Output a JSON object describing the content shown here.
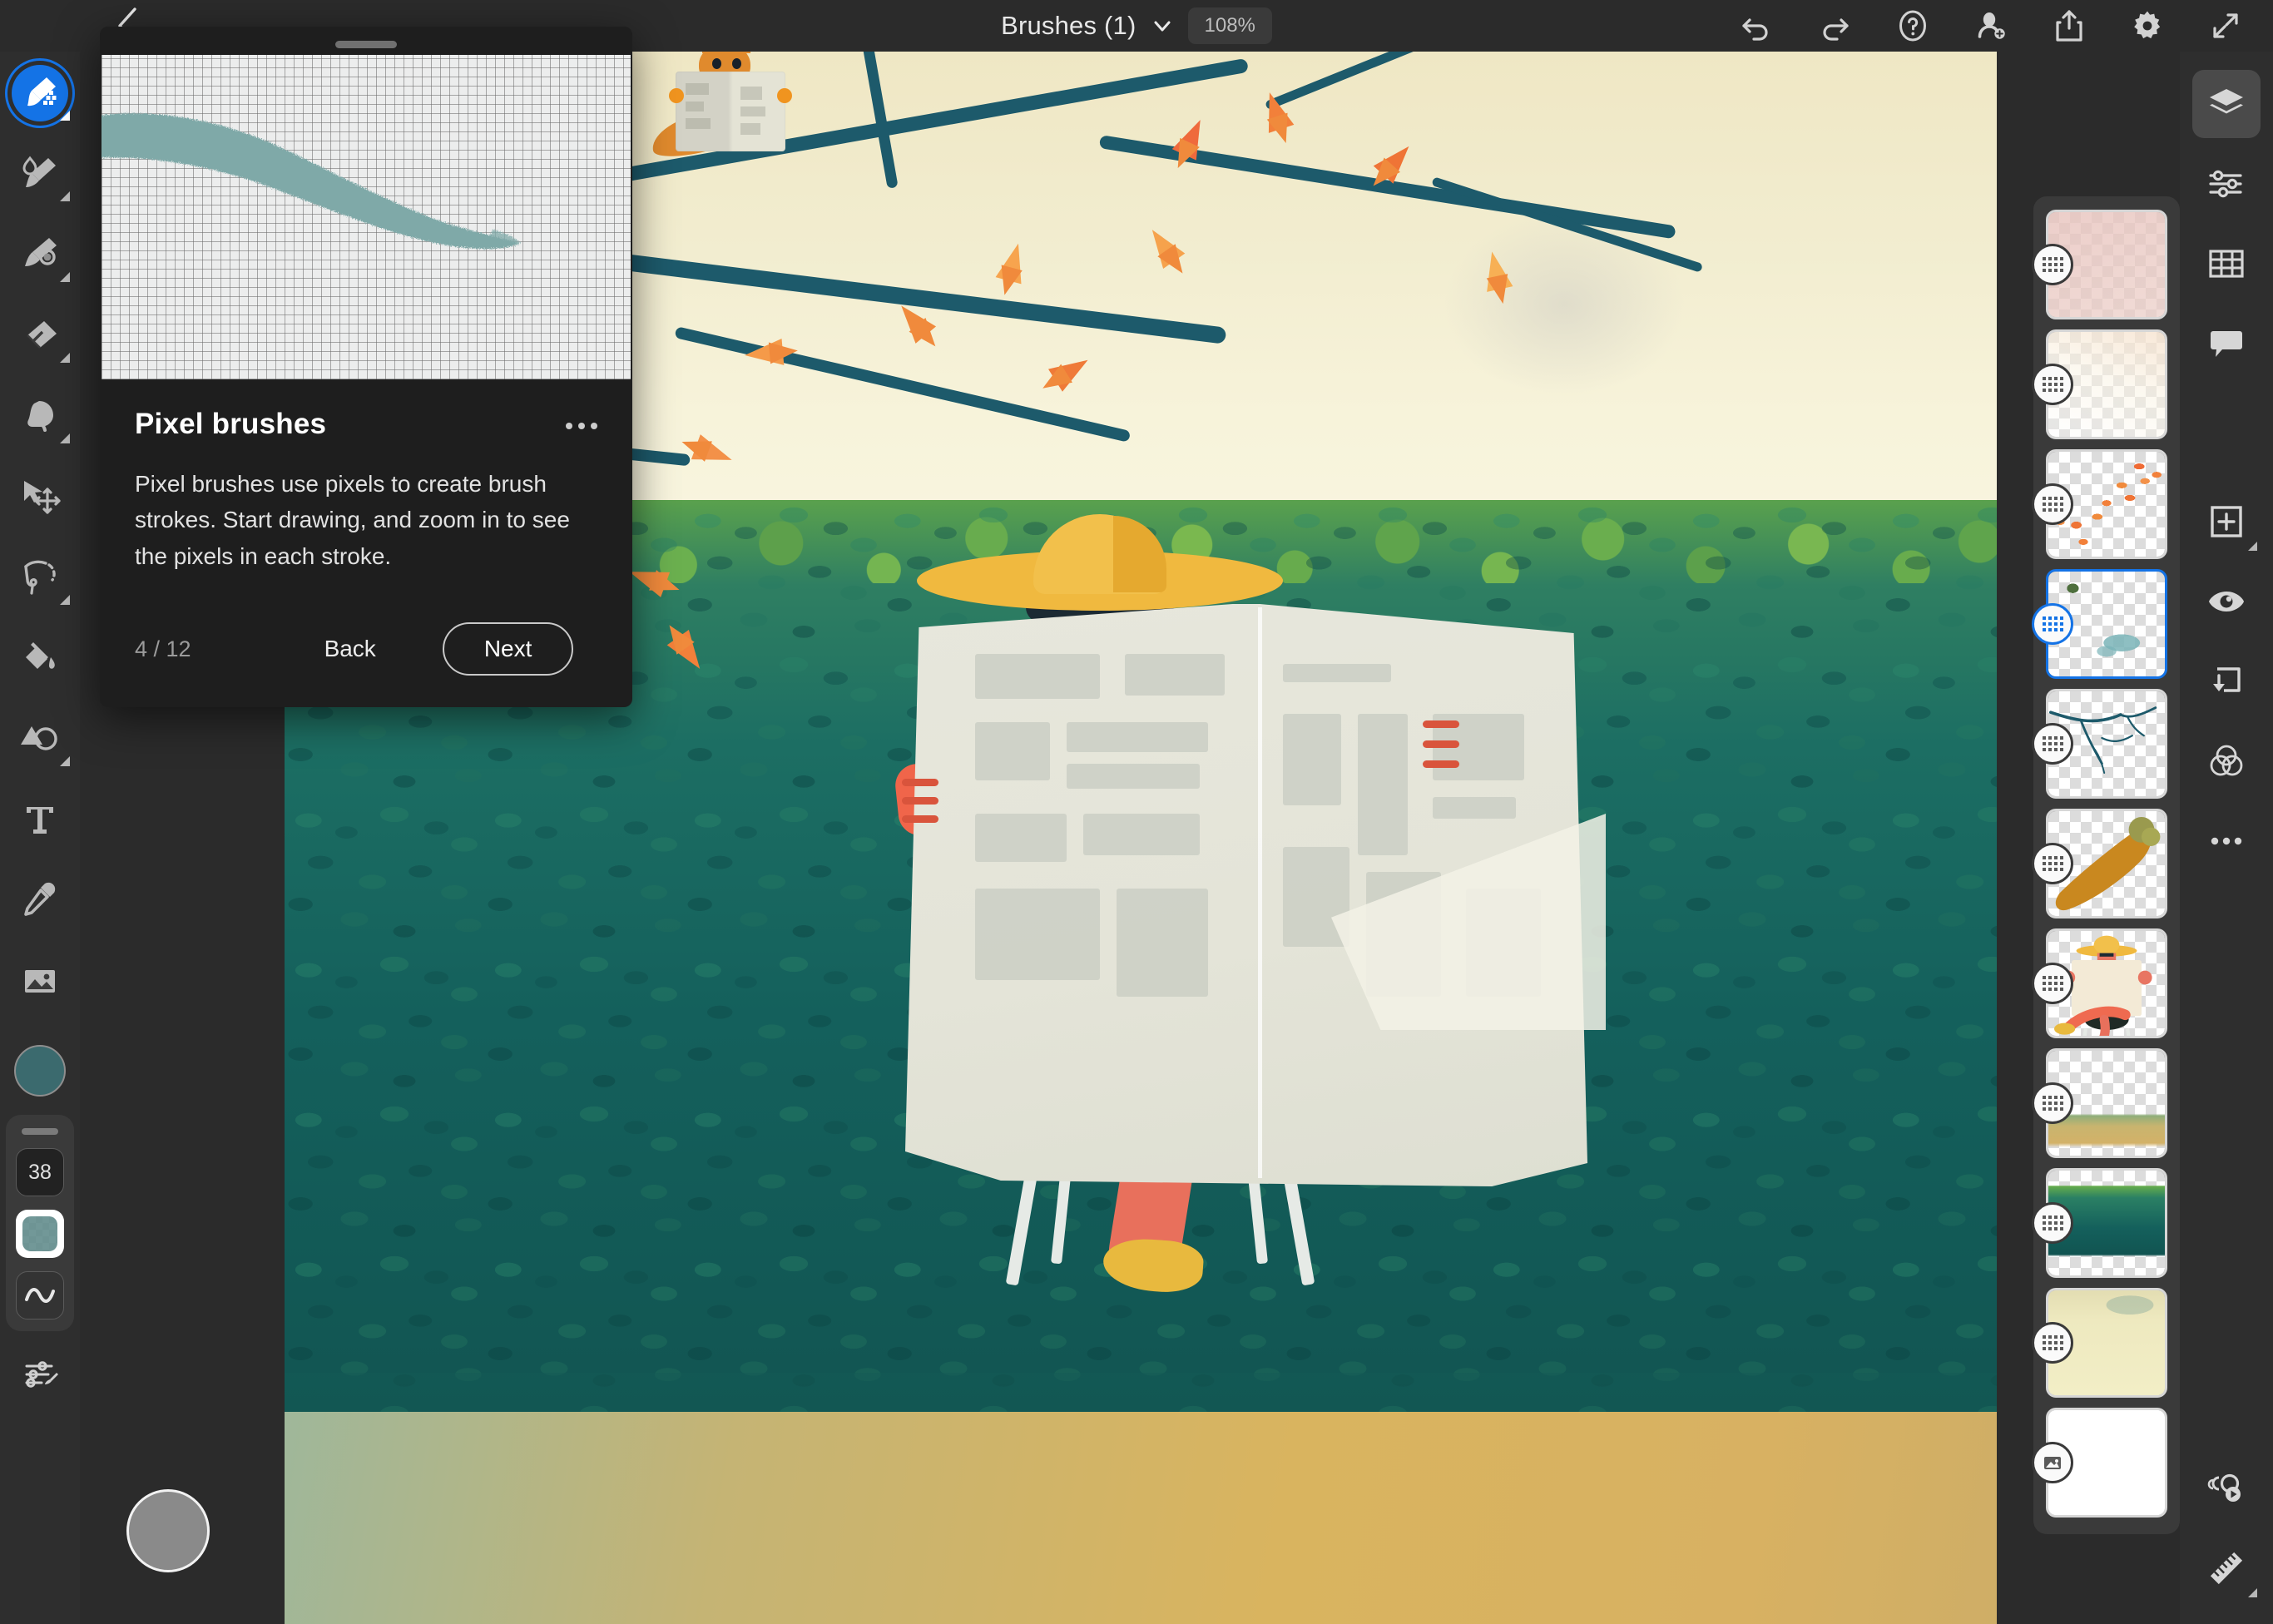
{
  "app": {
    "name": "Adobe Fresco",
    "theme_bg": "#2b2b2b",
    "accent": "#1473e6"
  },
  "topbar": {
    "back_icon": "chevron-left-icon",
    "title": "Brushes (1)",
    "title_chevron_icon": "chevron-down-icon",
    "zoom_level": "108%",
    "actions": [
      {
        "name": "undo-button",
        "icon": "undo-icon",
        "label": "Undo"
      },
      {
        "name": "redo-button",
        "icon": "redo-icon",
        "label": "Redo"
      },
      {
        "name": "help-button",
        "icon": "question-circle-icon",
        "label": "Help"
      },
      {
        "name": "invite-button",
        "icon": "person-add-icon",
        "label": "Invite"
      },
      {
        "name": "share-button",
        "icon": "share-upload-icon",
        "label": "Share"
      },
      {
        "name": "settings-button",
        "icon": "gear-icon",
        "label": "Settings"
      },
      {
        "name": "fullscreen-button",
        "icon": "expand-arrows-icon",
        "label": "Full screen"
      }
    ]
  },
  "left_toolbar": {
    "tools": [
      {
        "name": "pixel-brush-tool",
        "icon": "pixel-brush-icon",
        "label": "Pixel brush",
        "active": true,
        "has_flyout": true
      },
      {
        "name": "live-brush-tool",
        "icon": "live-brush-icon",
        "label": "Live brush",
        "active": false,
        "has_flyout": true
      },
      {
        "name": "vector-brush-tool",
        "icon": "vector-brush-icon",
        "label": "Vector brush",
        "active": false,
        "has_flyout": true
      },
      {
        "name": "eraser-tool",
        "icon": "eraser-icon",
        "label": "Eraser",
        "active": false,
        "has_flyout": true
      },
      {
        "name": "smudge-tool",
        "icon": "smudge-icon",
        "label": "Smudge",
        "active": false,
        "has_flyout": true
      },
      {
        "name": "transform-tool",
        "icon": "transform-move-icon",
        "label": "Transform",
        "active": false,
        "has_flyout": false
      },
      {
        "name": "lasso-select-tool",
        "icon": "lasso-select-icon",
        "label": "Selection",
        "active": false,
        "has_flyout": true
      },
      {
        "name": "fill-tool",
        "icon": "paint-bucket-icon",
        "label": "Fill",
        "active": false,
        "has_flyout": false
      },
      {
        "name": "shapes-tool",
        "icon": "shapes-icon",
        "label": "Shapes",
        "active": false,
        "has_flyout": true
      },
      {
        "name": "text-tool",
        "icon": "text-t-icon",
        "label": "Text",
        "active": false,
        "has_flyout": false
      },
      {
        "name": "eyedropper-tool",
        "icon": "eyedropper-icon",
        "label": "Eyedropper",
        "active": false,
        "has_flyout": false
      },
      {
        "name": "place-image-tool",
        "icon": "image-icon",
        "label": "Place image",
        "active": false,
        "has_flyout": false
      }
    ],
    "color_swatch": {
      "name": "color-swatch",
      "hex": "#3b6a6e",
      "label": "Current color"
    },
    "brush_size": "38",
    "brush_preview_color": "#668f8f",
    "smoothing_icon": "wave-smoothing-icon",
    "brush_settings_icon": "brush-settings-icon",
    "touch_shortcut": {
      "name": "touch-shortcut",
      "label": "Touch shortcut",
      "hex": "#8a8a8a"
    }
  },
  "coachmark": {
    "title": "Pixel brushes",
    "menu_icon": "more-options-icon",
    "body": "Pixel brushes use pixels to create brush strokes. Start drawing, and zoom in to see the pixels in each stroke.",
    "step": "4 / 12",
    "step_current": 4,
    "step_total": 12,
    "back_label": "Back",
    "next_label": "Next",
    "stroke_color": "#7fa9a8",
    "grid_color": "#6b6b6b",
    "media_bg": "#eceded"
  },
  "layers_panel": {
    "label": "Layers",
    "selected_index": 3,
    "layers": [
      {
        "name": "layer-thumbnail",
        "badge_icon": "pixel-layer-icon",
        "type": "pixel",
        "description": "Pink wash overlay"
      },
      {
        "name": "layer-thumbnail",
        "badge_icon": "pixel-layer-icon",
        "type": "pixel",
        "description": "Warm highlight gradient"
      },
      {
        "name": "layer-thumbnail",
        "badge_icon": "pixel-layer-icon",
        "type": "pixel",
        "description": "Orange falling leaves"
      },
      {
        "name": "layer-thumbnail",
        "badge_icon": "pixel-layer-icon",
        "type": "pixel",
        "description": "Teal brush sketch",
        "selected": true
      },
      {
        "name": "layer-thumbnail",
        "badge_icon": "pixel-layer-icon",
        "type": "pixel",
        "description": "Dark tree branches"
      },
      {
        "name": "layer-thumbnail",
        "badge_icon": "pixel-layer-icon",
        "type": "pixel",
        "description": "Orange squirrel tail"
      },
      {
        "name": "layer-thumbnail",
        "badge_icon": "pixel-layer-icon",
        "type": "pixel",
        "description": "Seated reader with newspaper"
      },
      {
        "name": "layer-thumbnail",
        "badge_icon": "pixel-layer-icon",
        "type": "pixel",
        "description": "Ground strip"
      },
      {
        "name": "layer-thumbnail",
        "badge_icon": "pixel-layer-icon",
        "type": "pixel",
        "description": "Green and teal hedge"
      },
      {
        "name": "layer-thumbnail",
        "badge_icon": "pixel-layer-icon",
        "type": "pixel",
        "description": "Cream sky wash"
      },
      {
        "name": "layer-thumbnail",
        "badge_icon": "image-layer-icon",
        "type": "image",
        "description": "White background"
      }
    ]
  },
  "right_rail": {
    "items": [
      {
        "name": "layers-panel-button",
        "icon": "layers-icon",
        "label": "Layers",
        "active": true
      },
      {
        "name": "adjustments-button",
        "icon": "sliders-icon",
        "label": "Adjustments",
        "active": false
      },
      {
        "name": "grid-button",
        "icon": "grid-icon",
        "label": "Grid and guides",
        "active": false
      },
      {
        "name": "comments-button",
        "icon": "comment-bubble-icon",
        "label": "Comments",
        "active": false
      },
      {
        "name": "add-layer-button",
        "icon": "plus-square-icon",
        "label": "Add layer",
        "active": false,
        "has_flyout": true
      },
      {
        "name": "layer-visibility-button",
        "icon": "eye-icon",
        "label": "Show or hide layer",
        "active": false
      },
      {
        "name": "clipping-mask-button",
        "icon": "merge-down-icon",
        "label": "Clipping mask",
        "active": false
      },
      {
        "name": "blend-mode-button",
        "icon": "blend-circles-icon",
        "label": "Blend mode",
        "active": false
      },
      {
        "name": "layer-more-button",
        "icon": "more-options-icon",
        "label": "More layer options",
        "active": false
      },
      {
        "name": "time-lapse-button",
        "icon": "time-lapse-icon",
        "label": "Time-lapse",
        "active": false
      },
      {
        "name": "ruler-button",
        "icon": "ruler-icon",
        "label": "Ruler",
        "active": false,
        "has_flyout": true
      }
    ]
  },
  "canvas": {
    "label": "Artwork canvas",
    "description": "Illustration of a person in a yellow sun hat and sunglasses reading a newspaper on a white chair in front of a teal green hedge, with autumn branches and a squirrel reading above.",
    "palette": {
      "sky": "#f2edd0",
      "hedge_light": "#5aa14d",
      "hedge_dark": "#115451",
      "ground": "#d9b45f",
      "branch": "#1d5a6b",
      "leaf": "#f08a3c",
      "hat": "#f0b93f",
      "skin": "#e87562",
      "newspaper": "#e4e4d8",
      "leg": "#ef6a50",
      "shoe": "#e8b93e",
      "chair": "#e6eae6",
      "squirrel": "#e08a2d"
    }
  }
}
